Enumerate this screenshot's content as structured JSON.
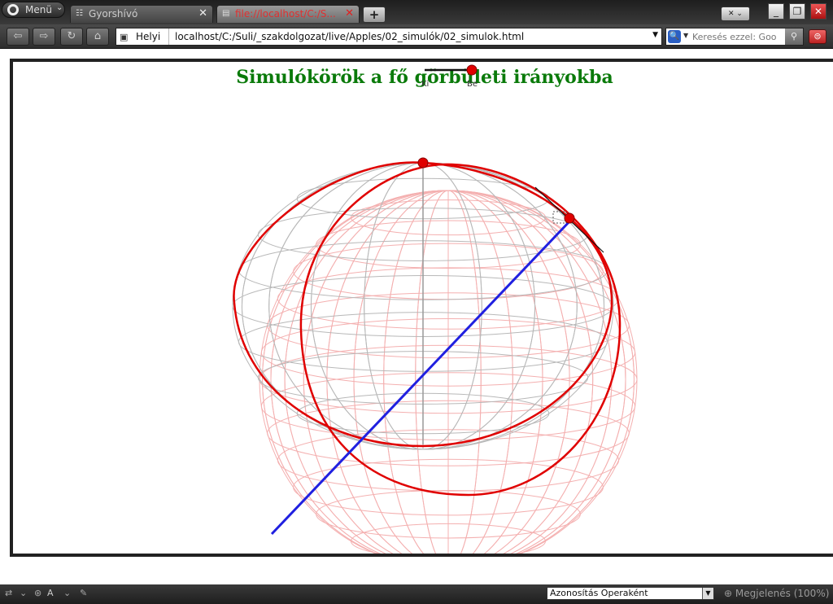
{
  "browser": {
    "menu_label": "Menü",
    "tabs": [
      {
        "label": "Gyorshívó",
        "icon": "speed-dial-icon",
        "active": false
      },
      {
        "label": "file://localhost/C:/S...",
        "icon": "page-icon",
        "active": true
      }
    ],
    "address": {
      "site_label": "Helyi",
      "url": "localhost/C:/Suli/_szakdolgozat/live/Apples/02_simulók/02_simulok.html"
    },
    "search": {
      "placeholder": "Keresés ezzel: Goo"
    }
  },
  "page": {
    "title": "Simulókörök a fő görbületi irányokba",
    "labels": {
      "point_top_left": "Ki",
      "point_top_right": "Be"
    }
  },
  "status": {
    "tab_mode": "A",
    "identity": "Azonosítás Operaként",
    "zoom": "Megjelenés (100%)"
  },
  "colors": {
    "title": "#0a7a0a",
    "sphere_mesh": "#f4b0b0",
    "sphere_grid": "#b8b8b8",
    "osculating_circle": "#e00000",
    "normal_line": "#2020e0"
  }
}
